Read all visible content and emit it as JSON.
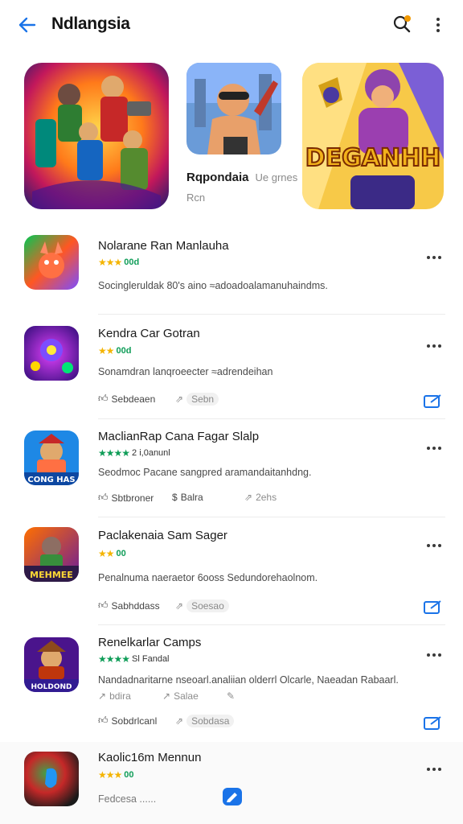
{
  "header": {
    "title": "Ndlangsia"
  },
  "featured": {
    "caption_title": "Rqpondaia",
    "caption_meta": "Ue grnes",
    "caption_sub": "Rcn",
    "banner_text": "DEGANHH"
  },
  "items": [
    {
      "name": "Nolarane Ran Manlauha",
      "rating": "00d",
      "stars": "★★★",
      "desc": "Socingleruldak 80's aino ≈adoadoalamanuhaindms."
    },
    {
      "name": "Kendra Car Gotran",
      "rating": "00d",
      "stars": "★★",
      "desc": "Sonamdran lanqroeecter ≈adrendeihan",
      "action1": "Sebdeaen",
      "action2": "Sebn"
    },
    {
      "name": "MaclianRap Cana Fagar Slalp",
      "rating": "2 i,0anunl",
      "stars": "★★★★",
      "desc": "Seodmoc Pacane sangpred aramandaitanhdng.",
      "action1": "Sbtbroner",
      "action2": "Balra",
      "action3": "2ehs",
      "icon_text": "CONG HAS"
    },
    {
      "name": "Paclakenaia Sam Sager",
      "rating": "00",
      "stars": "★★",
      "desc": "Penalnuma naeraetor 6ooss Sedundorehaolnom.",
      "action1": "Sabhddass",
      "action2": "Soesao",
      "icon_text": "MEHMEE"
    },
    {
      "name": "Renelkarlar Camps",
      "rating": "Sl Fandal",
      "stars": "★★★★",
      "desc": "Nandadnaritarne nseoarl.analiian olderrl Olcarle, Naeadan Rabaarl.",
      "action1": "bdira",
      "action2": "Salae",
      "action3": "Sobdrlcanl",
      "action4": "Sobdasa",
      "icon_text": "HOLDOND"
    },
    {
      "name": "Kaolic16m Mennun",
      "rating": "00",
      "stars": "★★★",
      "desc": "Fedcesa ......"
    }
  ],
  "colors": {
    "accent": "#1a73e8",
    "star": "#f4b400",
    "green": "#0f9d58"
  }
}
